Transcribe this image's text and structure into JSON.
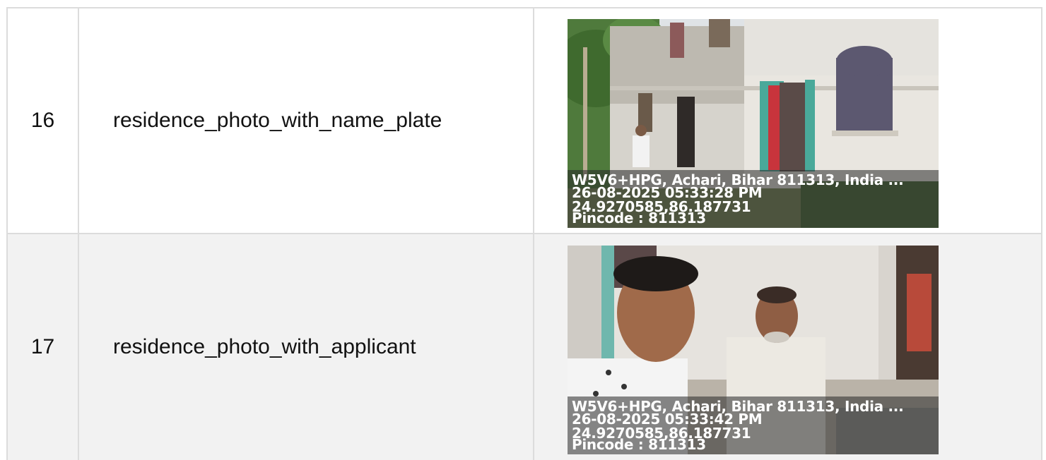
{
  "rows": [
    {
      "number": "16",
      "label": "residence_photo_with_name_plate",
      "stamp": {
        "address": "W5V6+HPG, Achari, Bihar 811313, India ...",
        "datetime": "26-08-2025 05:33:28 PM",
        "coords": "24.9270585,86.187731",
        "pincode": "Pincode : 811313"
      }
    },
    {
      "number": "17",
      "label": "residence_photo_with_applicant",
      "stamp": {
        "address": "W5V6+HPG, Achari, Bihar 811313, India ...",
        "datetime": "26-08-2025 05:33:42 PM",
        "coords": "24.9270585,86.187731",
        "pincode": "Pincode : 811313"
      }
    }
  ]
}
